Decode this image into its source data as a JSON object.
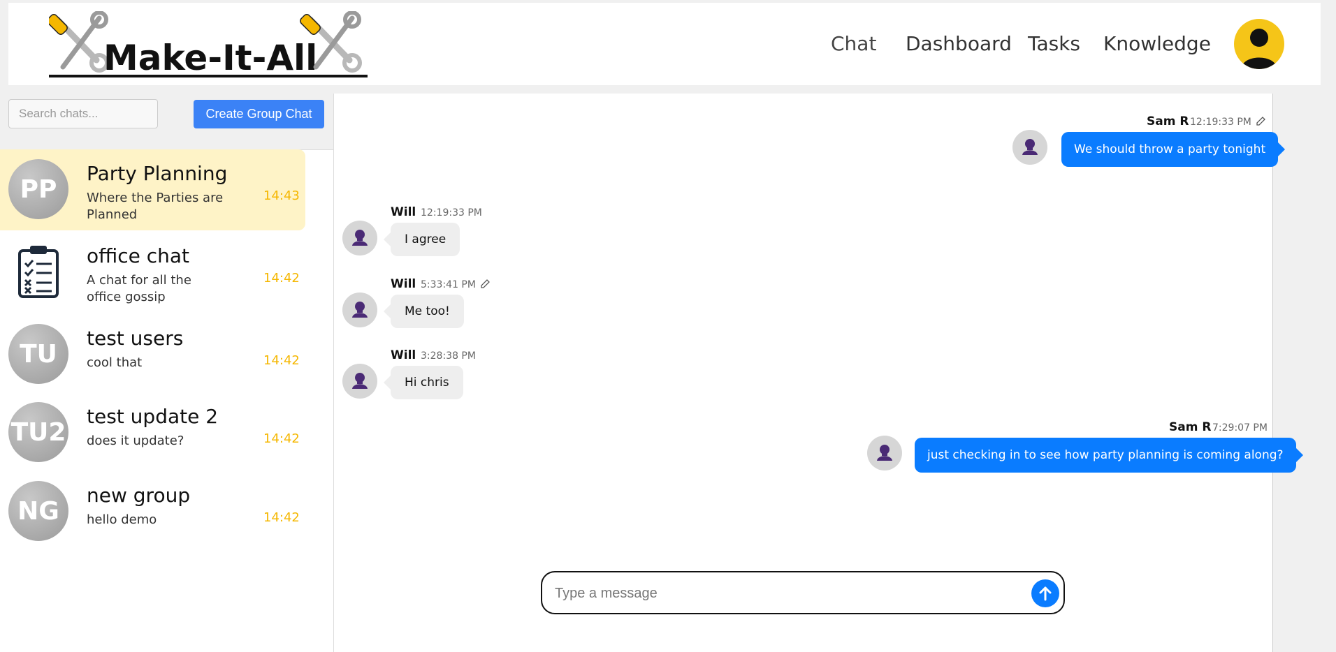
{
  "app": {
    "logo_text": "Make-It-All"
  },
  "nav": {
    "chat": "Chat",
    "dashboard": "Dashboard",
    "tasks": "Tasks",
    "knowledge": "Knowledge"
  },
  "sidebar": {
    "search_placeholder": "Search chats...",
    "create_label": "Create Group Chat",
    "chats": [
      {
        "initials": "PP",
        "name": "Party Planning",
        "description": "Where the Parties are Planned",
        "time": "14:43",
        "active": true
      },
      {
        "initials": "",
        "icon": "clipboard-checklist-icon",
        "name": "office chat",
        "description": "A chat for all the office gossip",
        "time": "14:42"
      },
      {
        "initials": "TU",
        "name": "test users",
        "description": "cool that",
        "time": "14:42"
      },
      {
        "initials": "TU2",
        "name": "test update 2",
        "description": "does it update?",
        "time": "14:42"
      },
      {
        "initials": "NG",
        "name": "new group",
        "description": "hello demo",
        "time": "14:42"
      }
    ]
  },
  "messages": [
    {
      "sender": "Sam R",
      "time": "12:19:33 PM",
      "text": "We should throw a party tonight",
      "outgoing": true,
      "editable": true
    },
    {
      "sender": "Will",
      "time": "12:19:33 PM",
      "text": "I agree",
      "outgoing": false
    },
    {
      "sender": "Will",
      "time": "5:33:41 PM",
      "text": "Me too!",
      "outgoing": false,
      "editable": true
    },
    {
      "sender": "Will",
      "time": "3:28:38 PM",
      "text": "Hi chris",
      "outgoing": false
    },
    {
      "sender": "Sam R",
      "time": "7:29:07 PM",
      "text": "just checking in to see how party planning is coming along?",
      "outgoing": true
    }
  ],
  "composer": {
    "placeholder": "Type a message"
  },
  "colors": {
    "accent_blue": "#0a7cff",
    "button_blue": "#3b82f6",
    "time_yellow": "#f5b700",
    "active_chat_bg": "#fef3c7",
    "avatar_yellow": "#f5c518"
  }
}
